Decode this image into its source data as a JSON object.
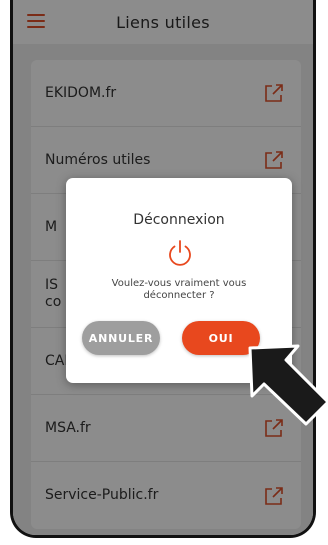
{
  "appbar": {
    "title": "Liens utiles",
    "menu_icon": "hamburger-menu-icon"
  },
  "colors": {
    "accent": "#e0502a",
    "button_ok": "#e8481e",
    "button_cancel": "#9e9e9e",
    "text": "#333333"
  },
  "links": [
    {
      "label": "EKIDOM.fr"
    },
    {
      "label": "Numéros utiles"
    },
    {
      "label": "M"
    },
    {
      "label": "IS\nco"
    },
    {
      "label": "CAF.fr"
    },
    {
      "label": "MSA.fr"
    },
    {
      "label": "Service-Public.fr"
    }
  ],
  "dialog": {
    "title": "Déconnexion",
    "icon": "power-icon",
    "message": "Voulez-vous vraiment vous déconnecter ?",
    "cancel_label": "ANNULER",
    "confirm_label": "OUI"
  }
}
